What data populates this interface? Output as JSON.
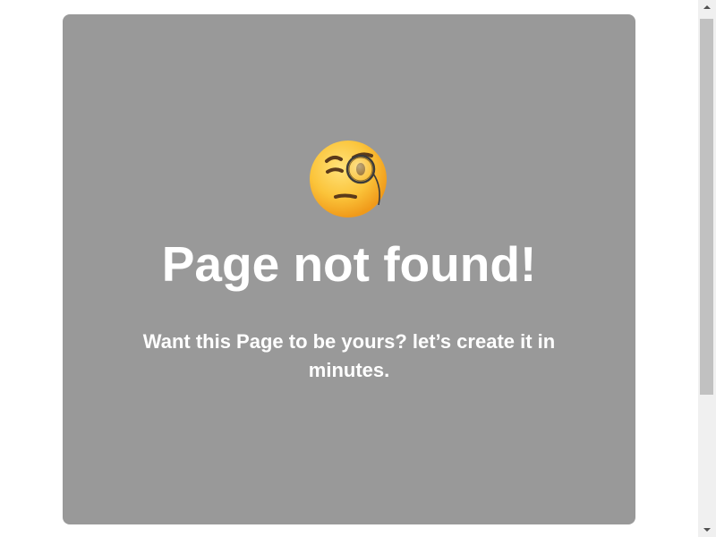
{
  "error_page": {
    "icon": "face-with-monocle-icon",
    "title": "Page not found!",
    "message": "Want this Page to be yours? let’s create it in minutes."
  },
  "colors": {
    "card_background": "#999999",
    "text": "#ffffff",
    "page_background": "#ffffff",
    "scrollbar_track": "#f0f0f0",
    "scrollbar_thumb": "#c1c1c1"
  },
  "scrollbar": {
    "position": 0
  }
}
